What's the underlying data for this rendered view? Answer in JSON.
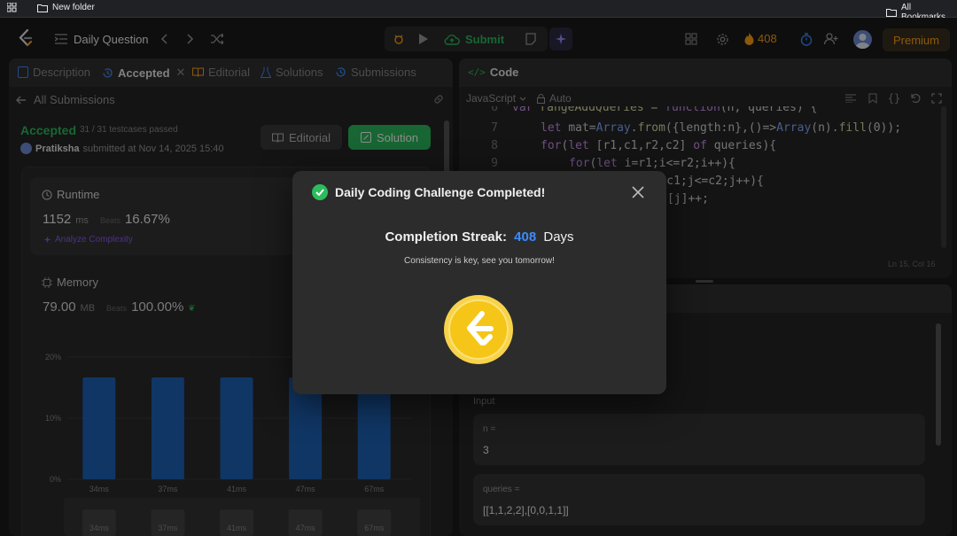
{
  "bookmarks": {
    "folder": "New folder",
    "all": "All Bookmarks"
  },
  "nav": {
    "title": "Daily Question",
    "submit": "Submit",
    "streak_count": "408",
    "premium": "Premium"
  },
  "left_panel": {
    "tabs": [
      "Description",
      "Accepted",
      "Editorial",
      "Solutions",
      "Submissions"
    ],
    "back_link": "All Submissions",
    "status": "Accepted",
    "testcases": "31 / 31 testcases passed",
    "user": "Pratiksha",
    "submitted_at": "submitted at Nov 14, 2025 15:40",
    "editorial_btn": "Editorial",
    "solution_btn": "Solution",
    "runtime": {
      "label": "Runtime",
      "value": "1152",
      "unit": "ms",
      "beats_label": "Beats",
      "beats": "16.67%",
      "analyze": "Analyze Complexity"
    },
    "memory": {
      "label": "Memory",
      "value": "79.00",
      "unit": "MB",
      "beats_label": "Beats",
      "beats": "100.00%"
    }
  },
  "chart_data": {
    "type": "bar",
    "categories": [
      "34ms",
      "37ms",
      "41ms",
      "47ms",
      "67ms"
    ],
    "values": [
      16.67,
      16.67,
      16.67,
      16.67,
      16.67
    ],
    "y_ticks": [
      "20%",
      "10%",
      "0%"
    ],
    "ylim": [
      0,
      20
    ],
    "grid": true,
    "bar_color": "#1e63b8"
  },
  "code_panel": {
    "title": "Code",
    "language": "JavaScript",
    "mode": "Auto",
    "cursor": "Ln 15, Col 16",
    "line_numbers": [
      "6",
      "7",
      "8",
      "9"
    ]
  },
  "testcase_panel": {
    "input_label": "Input",
    "fields": [
      {
        "label": "n =",
        "value": "3"
      },
      {
        "label": "queries =",
        "value": "[[1,1,2,2],[0,0,1,1]]"
      }
    ]
  },
  "modal": {
    "title": "Daily Coding Challenge Completed!",
    "streak_label": "Completion Streak:",
    "streak_value": "408",
    "streak_unit": "Days",
    "message": "Consistency is key, see you tomorrow!"
  },
  "colors": {
    "accent_green": "#2cbb5d",
    "accent_blue": "#3b8bff",
    "coin": "#f5c518",
    "orange": "#ffa116"
  }
}
